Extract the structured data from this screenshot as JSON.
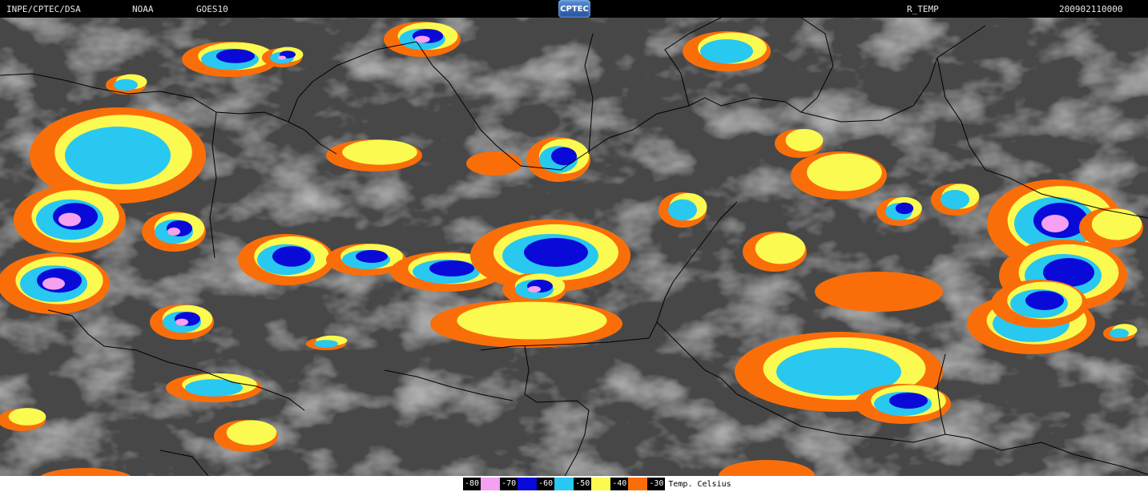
{
  "header": {
    "source": "INPE/CPTEC/DSA",
    "agency": "NOAA",
    "satellite": "GOES10",
    "logo_text": "CPTEC",
    "product": "R_TEMP",
    "datetime": "200902110000"
  },
  "legend": {
    "items": [
      {
        "label": "-80",
        "color": "#f5a0f0"
      },
      {
        "label": "-70",
        "color": "#0a0ad8"
      },
      {
        "label": "-60",
        "color": "#28c8f0"
      },
      {
        "label": "-50",
        "color": "#fafa50"
      },
      {
        "label": "-40",
        "color": "#fa6e0a"
      },
      {
        "label": "-30",
        "color": ""
      }
    ],
    "title": "Temp. Celsius"
  },
  "colors": {
    "background": "#4a4a4a",
    "borders": "#000000",
    "orange": "#fa6e0a",
    "yellow": "#fafa50",
    "cyan": "#28c8f0",
    "blue": "#0a0ad8",
    "pink": "#f5a0f0"
  }
}
